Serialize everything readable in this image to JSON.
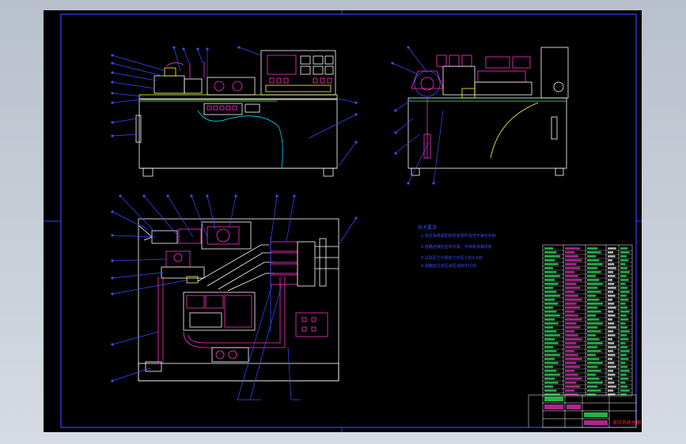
{
  "drawing": {
    "background_color": "#000000",
    "frame_color": "#3344ff",
    "line_color": "#ffffff",
    "leader_color": "#3b4cff",
    "cyan_color": "#00d8ff",
    "magenta_color": "#ff33cc",
    "green_color": "#33ff66",
    "yellow_color": "#ffff33",
    "red_color": "#ff2222",
    "technical_requirements": {
      "title": "技术要求",
      "lines": [
        "1.液压系统装配前所有零件清洗干净无毛刺",
        "2.管路连接处密封可靠，不得有渗漏现象",
        "3.试验压力为额定工作压力的1.5倍",
        "4.油箱加注液压油至油标中位线"
      ]
    },
    "title_block": {
      "drawing_title": "液压系统总图"
    }
  }
}
